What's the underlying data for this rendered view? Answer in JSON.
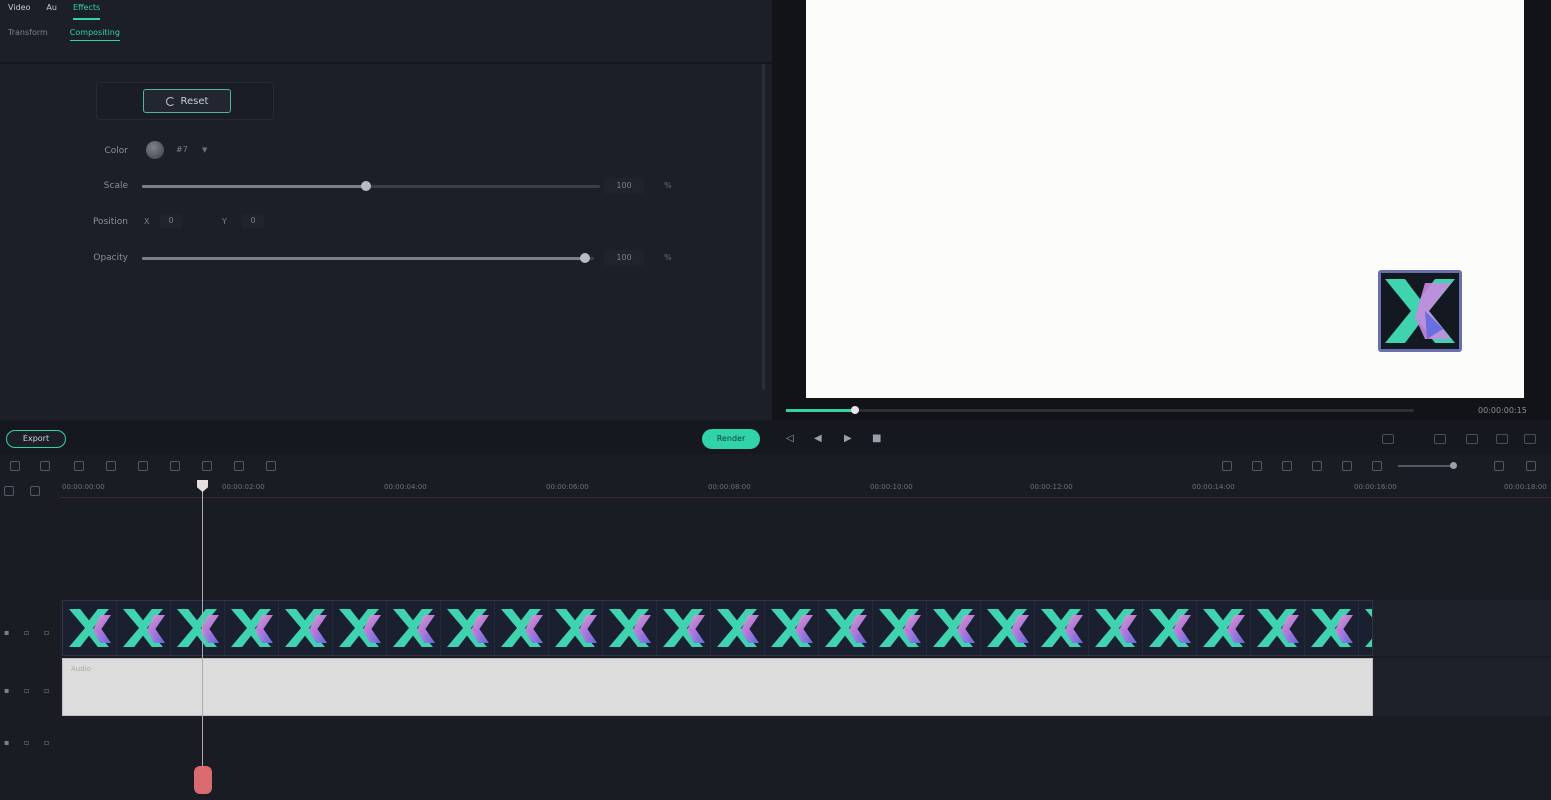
{
  "menu": {
    "tabs": [
      {
        "label": "Video"
      },
      {
        "label": "Au"
      },
      {
        "label": "Effects"
      }
    ]
  },
  "properties": {
    "subtabs": [
      {
        "label": "Transform"
      },
      {
        "label": "Compositing"
      }
    ],
    "reset_label": "Reset",
    "fields": {
      "color": {
        "label": "Color",
        "value": "#7"
      },
      "scale": {
        "label": "Scale",
        "value": "100",
        "unit": "%",
        "fraction": 0.49
      },
      "position": {
        "label": "Position",
        "x_label": "X",
        "x_value": "0",
        "y_label": "Y",
        "y_value": "0"
      },
      "opacity": {
        "label": "Opacity",
        "value": "100",
        "unit": "%",
        "fraction": 0.98
      }
    }
  },
  "preview": {
    "timecode": "00:00:00:15",
    "progress_fraction": 0.11
  },
  "controls": {
    "export_label": "Export",
    "render_label": "Render",
    "playback": [
      {
        "name": "prev-frame-icon",
        "glyph": "◁"
      },
      {
        "name": "step-back-icon",
        "glyph": "◀"
      },
      {
        "name": "play-icon",
        "glyph": "▶"
      },
      {
        "name": "stop-icon",
        "glyph": "■"
      }
    ]
  },
  "timeline": {
    "ruler": [
      "00:00:00:00",
      "00:00:02:00",
      "00:00:04:00",
      "00:00:06:00",
      "00:00:08:00",
      "00:00:10:00",
      "00:00:12:00",
      "00:00:14:00",
      "00:00:16:00",
      "00:00:18:00"
    ],
    "audio_clip_label": "Audio",
    "colors": {
      "accent": "#31d3a9",
      "playhead": "#d86a70"
    }
  }
}
